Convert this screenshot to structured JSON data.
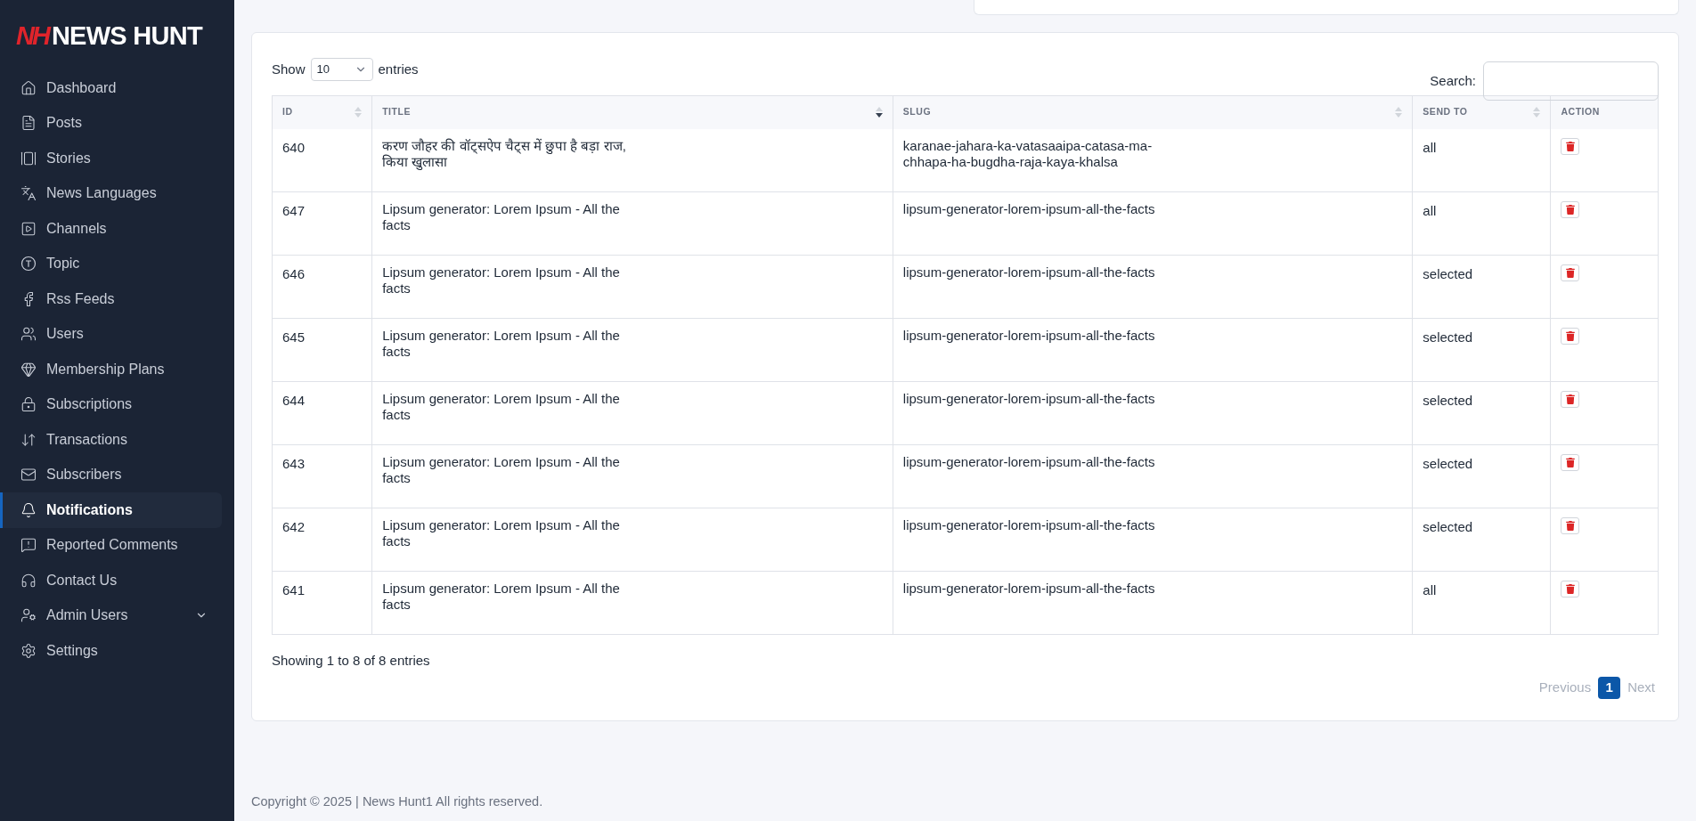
{
  "logo": {
    "mark": "NH",
    "text": "NEWS HUNT"
  },
  "sidebar": {
    "items": [
      {
        "label": "Dashboard",
        "selected": false
      },
      {
        "label": "Posts",
        "selected": false
      },
      {
        "label": "Stories",
        "selected": false
      },
      {
        "label": "News Languages",
        "selected": false
      },
      {
        "label": "Channels",
        "selected": false
      },
      {
        "label": "Topic",
        "selected": false
      },
      {
        "label": "Rss Feeds",
        "selected": false
      },
      {
        "label": "Users",
        "selected": false
      },
      {
        "label": "Membership Plans",
        "selected": false
      },
      {
        "label": "Subscriptions",
        "selected": false
      },
      {
        "label": "Transactions",
        "selected": false
      },
      {
        "label": "Subscribers",
        "selected": false
      },
      {
        "label": "Notifications",
        "selected": true
      },
      {
        "label": "Reported Comments",
        "selected": false
      },
      {
        "label": "Contact Us",
        "selected": false
      },
      {
        "label": "Admin Users",
        "selected": false,
        "expanded": false
      },
      {
        "label": "Settings",
        "selected": false
      }
    ]
  },
  "length_control": {
    "before": "Show",
    "value": "10",
    "after": "entries"
  },
  "search": {
    "label": "Search:"
  },
  "table": {
    "columns": [
      {
        "label": "ID",
        "sortable": true,
        "sorted": false
      },
      {
        "label": "TITLE",
        "sortable": true,
        "sorted": true
      },
      {
        "label": "SLUG",
        "sortable": true,
        "sorted": false
      },
      {
        "label": "SEND TO",
        "sortable": true,
        "sorted": false
      },
      {
        "label": "ACTION"
      }
    ],
    "rows": [
      {
        "id": "640",
        "title": "करण जौहर की वॉट्सऐप चैट्स में छुपा है बड़ा राज, किया खुलासा",
        "slug": "karanae-jahara-ka-vatasaaipa-catasa-ma-chhapa-ha-bugdha-raja-kaya-khalsa",
        "send_to": "all"
      },
      {
        "id": "647",
        "title": "Lipsum generator: Lorem Ipsum - All the facts",
        "slug": "lipsum-generator-lorem-ipsum-all-the-facts",
        "send_to": "all"
      },
      {
        "id": "646",
        "title": "Lipsum generator: Lorem Ipsum - All the facts",
        "slug": "lipsum-generator-lorem-ipsum-all-the-facts",
        "send_to": "selected"
      },
      {
        "id": "645",
        "title": "Lipsum generator: Lorem Ipsum - All the facts",
        "slug": "lipsum-generator-lorem-ipsum-all-the-facts",
        "send_to": "selected"
      },
      {
        "id": "644",
        "title": "Lipsum generator: Lorem Ipsum - All the facts",
        "slug": "lipsum-generator-lorem-ipsum-all-the-facts",
        "send_to": "selected"
      },
      {
        "id": "643",
        "title": "Lipsum generator: Lorem Ipsum - All the facts",
        "slug": "lipsum-generator-lorem-ipsum-all-the-facts",
        "send_to": "selected"
      },
      {
        "id": "642",
        "title": "Lipsum generator: Lorem Ipsum - All the facts",
        "slug": "lipsum-generator-lorem-ipsum-all-the-facts",
        "send_to": "selected"
      },
      {
        "id": "641",
        "title": "Lipsum generator: Lorem Ipsum - All the facts",
        "slug": "lipsum-generator-lorem-ipsum-all-the-facts",
        "send_to": "all"
      }
    ]
  },
  "info": "Showing 1 to 8 of 8 entries",
  "pagination": {
    "previous": {
      "label": "Previous",
      "disabled": true
    },
    "pages": [
      {
        "label": "1",
        "selected": true
      }
    ],
    "next": {
      "label": "Next",
      "disabled": true
    }
  },
  "footer": "Copyright © 2025 | News Hunt1 All rights reserved."
}
